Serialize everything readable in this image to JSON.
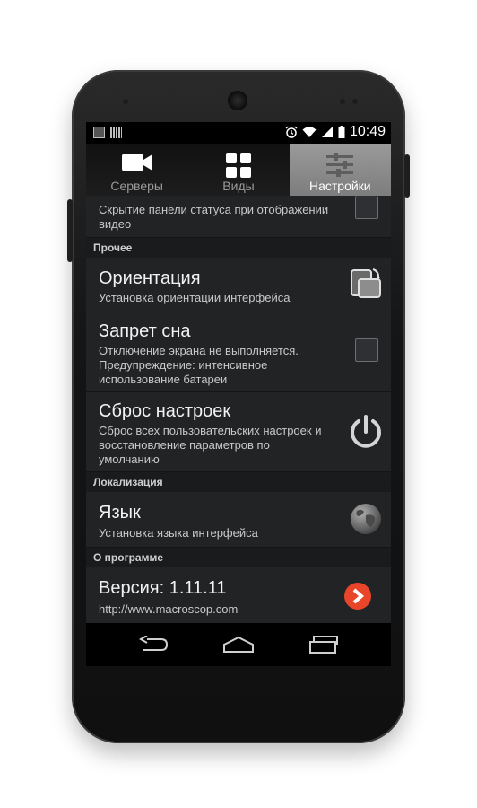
{
  "statusbar": {
    "time": "10:49"
  },
  "tabs": [
    {
      "label": "Серверы",
      "icon": "camera-icon",
      "active": false
    },
    {
      "label": "Виды",
      "icon": "grid-icon",
      "active": false
    },
    {
      "label": "Настройки",
      "icon": "sliders-icon",
      "active": true
    }
  ],
  "settings": {
    "statusbar_hide_desc": "Скрытие панели статуса при отображении видео",
    "sections": {
      "other": "Прочее",
      "localization": "Локализация",
      "about": "О программе"
    },
    "orientation": {
      "title": "Ориентация",
      "desc": "Установка ориентации интерфейса",
      "icon": "rotate-screen-icon"
    },
    "no_sleep": {
      "title": "Запрет сна",
      "desc": "Отключение экрана не выполняется. Предупреждение: интенсивное использование батареи",
      "checked": false
    },
    "reset": {
      "title": "Сброс настроек",
      "desc": "Сброс всех пользовательских настроек и восстановление параметров по умолчанию",
      "icon": "power-icon"
    },
    "language": {
      "title": "Язык",
      "desc": "Установка языка интерфейса",
      "icon": "globe-icon"
    },
    "version": {
      "title": "Версия: 1.11.11",
      "desc": "http://www.macroscop.com",
      "icon": "chevron-right-icon"
    }
  },
  "navbar": {
    "icons": [
      "back-icon",
      "home-icon",
      "recents-icon"
    ]
  },
  "colors": {
    "accent": "#e8452a",
    "active_tab": "#8a8a8a",
    "row_bg": "#222325"
  }
}
